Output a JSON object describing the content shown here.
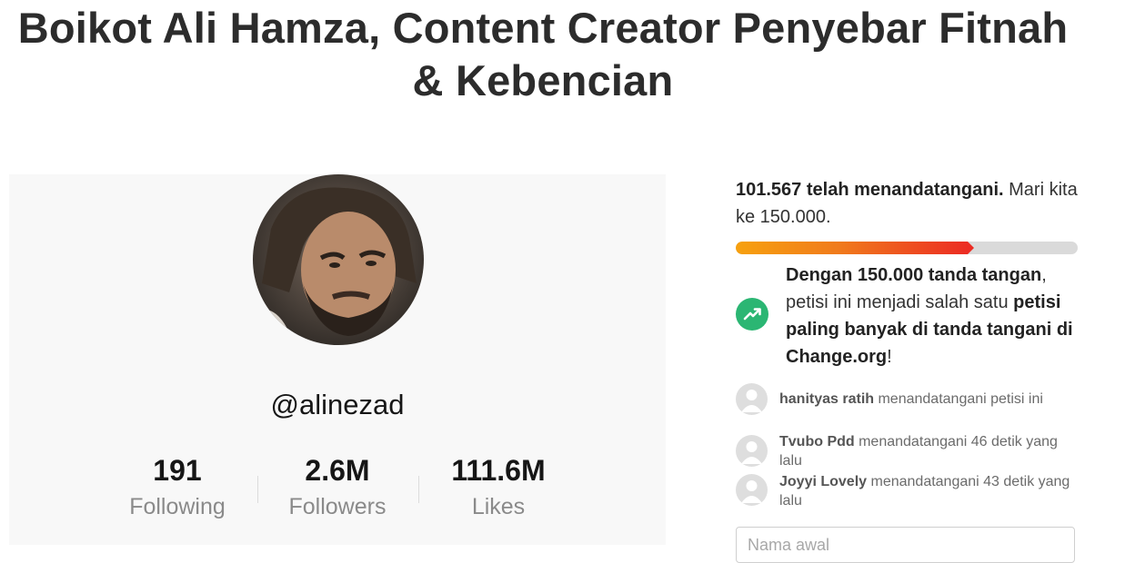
{
  "petition": {
    "title": "Boikot Ali Hamza, Content Creator Penyebar Fitnah & Kebencian"
  },
  "profile": {
    "handle": "@alinezad",
    "stats": [
      {
        "value": "191",
        "label": "Following"
      },
      {
        "value": "2.6M",
        "label": "Followers"
      },
      {
        "value": "111.6M",
        "label": "Likes"
      }
    ]
  },
  "progress": {
    "count_bold": "101.567 telah menandatangani.",
    "count_rest": " Mari kita ke 150.000.",
    "fraction": 0.677,
    "colors": {
      "start": "#f7a10f",
      "end": "#ec2c23",
      "track": "#dadada"
    }
  },
  "milestone": {
    "icon": "trending-up-icon",
    "icon_color": "#2bb673",
    "part1_bold": "Dengan 150.000 tanda tangan",
    "part2": ", petisi ini menjadi salah satu ",
    "part3_bold": "petisi paling banyak di tanda tangani di Change.org",
    "part4": "!"
  },
  "signers": [
    {
      "name": "hanityas ratih",
      "action": " menandatangani petisi ini"
    },
    {
      "name": "Tvubo Pdd",
      "action": " menandatangani 46 detik yang lalu"
    },
    {
      "name": "Joyyi Lovely",
      "action": " menandatangani 43 detik yang lalu"
    }
  ],
  "form": {
    "first_name_placeholder": "Nama awal"
  }
}
